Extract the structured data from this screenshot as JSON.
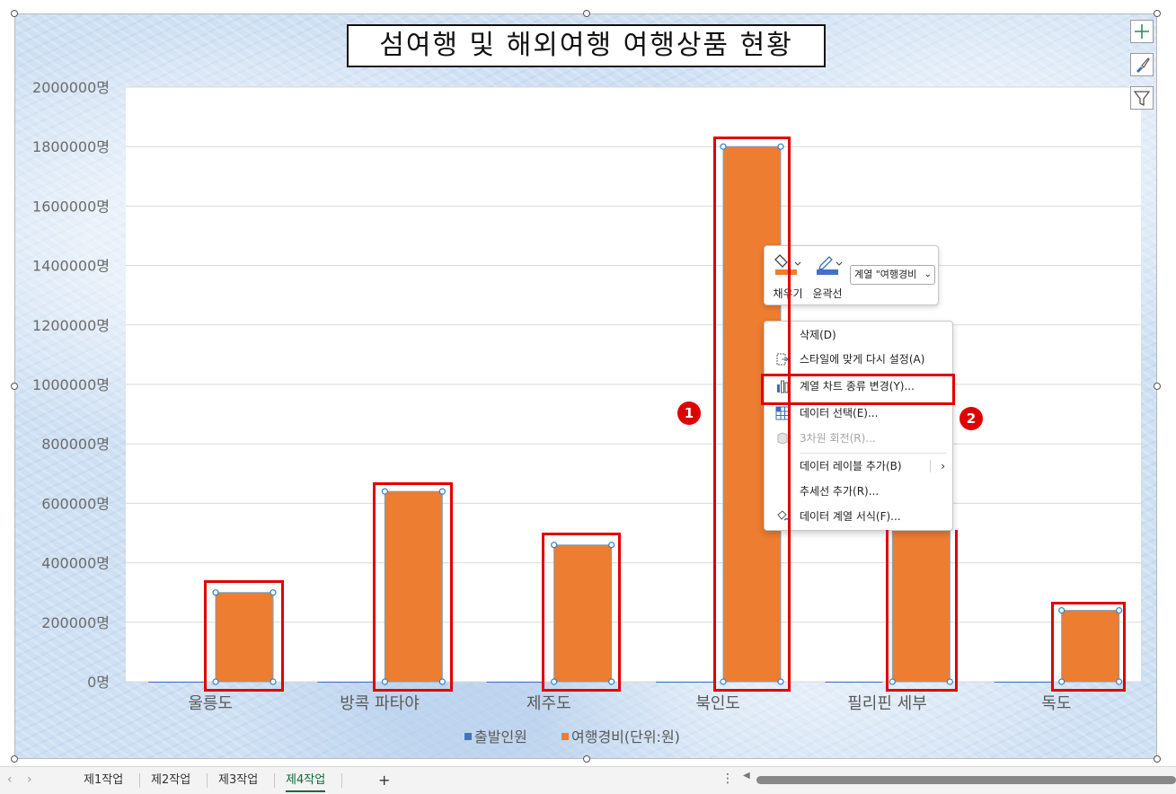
{
  "colors": {
    "series1": "#4472c4",
    "series2": "#ed7d31",
    "highlight": "#e00000",
    "active_tab": "#0d6b37"
  },
  "chart_data": {
    "type": "bar",
    "title": "섬여행 및 해외여행 여행상품 현황",
    "categories": [
      "울릉도",
      "방콕 파타야",
      "제주도",
      "북인도",
      "필리핀 세부",
      "독도"
    ],
    "series": [
      {
        "name": "출발인원",
        "values": [
          24,
          20,
          35,
          29,
          30,
          23
        ]
      },
      {
        "name": "여행경비(단위:원)",
        "values": [
          300000,
          640000,
          460000,
          1800000,
          520000,
          240000
        ]
      }
    ],
    "ylim": [
      0,
      2000000
    ],
    "yticks": [
      "0명",
      "200000명",
      "400000명",
      "600000명",
      "800000명",
      "1000000명",
      "1200000명",
      "1400000명",
      "1600000명",
      "1800000명",
      "2000000명"
    ],
    "legend_position": "bottom",
    "grid": true
  },
  "side_buttons": {
    "add": "plus-icon",
    "style": "brush-icon",
    "filter": "funnel-icon"
  },
  "mini_toolbar": {
    "fill_label": "채우기",
    "outline_label": "윤곽선",
    "series_select": "계열 \"여행경비"
  },
  "context_menu": {
    "items": [
      {
        "label": "삭제(D)",
        "icon": ""
      },
      {
        "label": "스타일에 맞게 다시 설정(A)",
        "icon": "reset-style-icon"
      },
      {
        "label": "계열 차트 종류 변경(Y)...",
        "icon": "change-chart-type-icon"
      },
      {
        "label": "데이터 선택(E)...",
        "icon": "select-data-icon"
      },
      {
        "label": "3차원 회전(R)...",
        "icon": "3d-rotation-icon"
      },
      {
        "label": "데이터 레이블 추가(B)",
        "icon": ""
      },
      {
        "label": "추세선 추가(R)...",
        "icon": ""
      },
      {
        "label": "데이터 계열 서식(F)...",
        "icon": "format-series-icon"
      }
    ]
  },
  "badges": {
    "b1": "1",
    "b2": "2"
  },
  "sheet_tabs": {
    "tabs": [
      "제1작업",
      "제2작업",
      "제3작업",
      "제4작업"
    ],
    "active": "제4작업",
    "add": "+"
  }
}
